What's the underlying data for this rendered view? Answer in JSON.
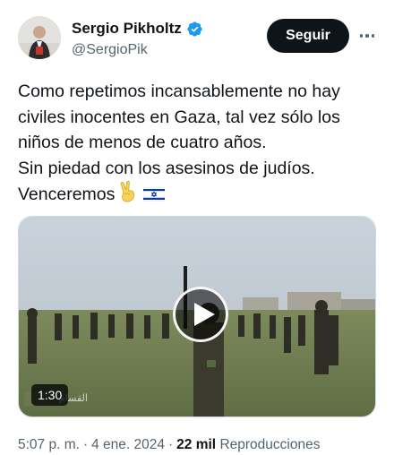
{
  "author": {
    "display_name": "Sergio Pikholtz",
    "handle": "@SergioPik",
    "verified": true,
    "verified_color": "#1d9bf0"
  },
  "follow_button": {
    "label": "Seguir",
    "bg": "#0f1419",
    "fg": "#ffffff"
  },
  "more_icon": "more-horizontal-icon",
  "tweet": {
    "lines": [
      "Como repetimos incansablemente no hay",
      "civiles inocentes en Gaza, tal vez sólo los",
      "niños de menos de cuatro años.",
      "Sin piedad con los asesinos de judíos.",
      "Venceremos"
    ],
    "emoji": "✌️",
    "flag_icon": "israel-flag-icon"
  },
  "media": {
    "type": "video",
    "duration": "1:30",
    "play_icon": "play-icon"
  },
  "meta": {
    "time": "5:07 p. m.",
    "date": "4 ene. 2024",
    "separator": "·",
    "views_count": "22 mil",
    "views_label": "Reproducciones"
  }
}
